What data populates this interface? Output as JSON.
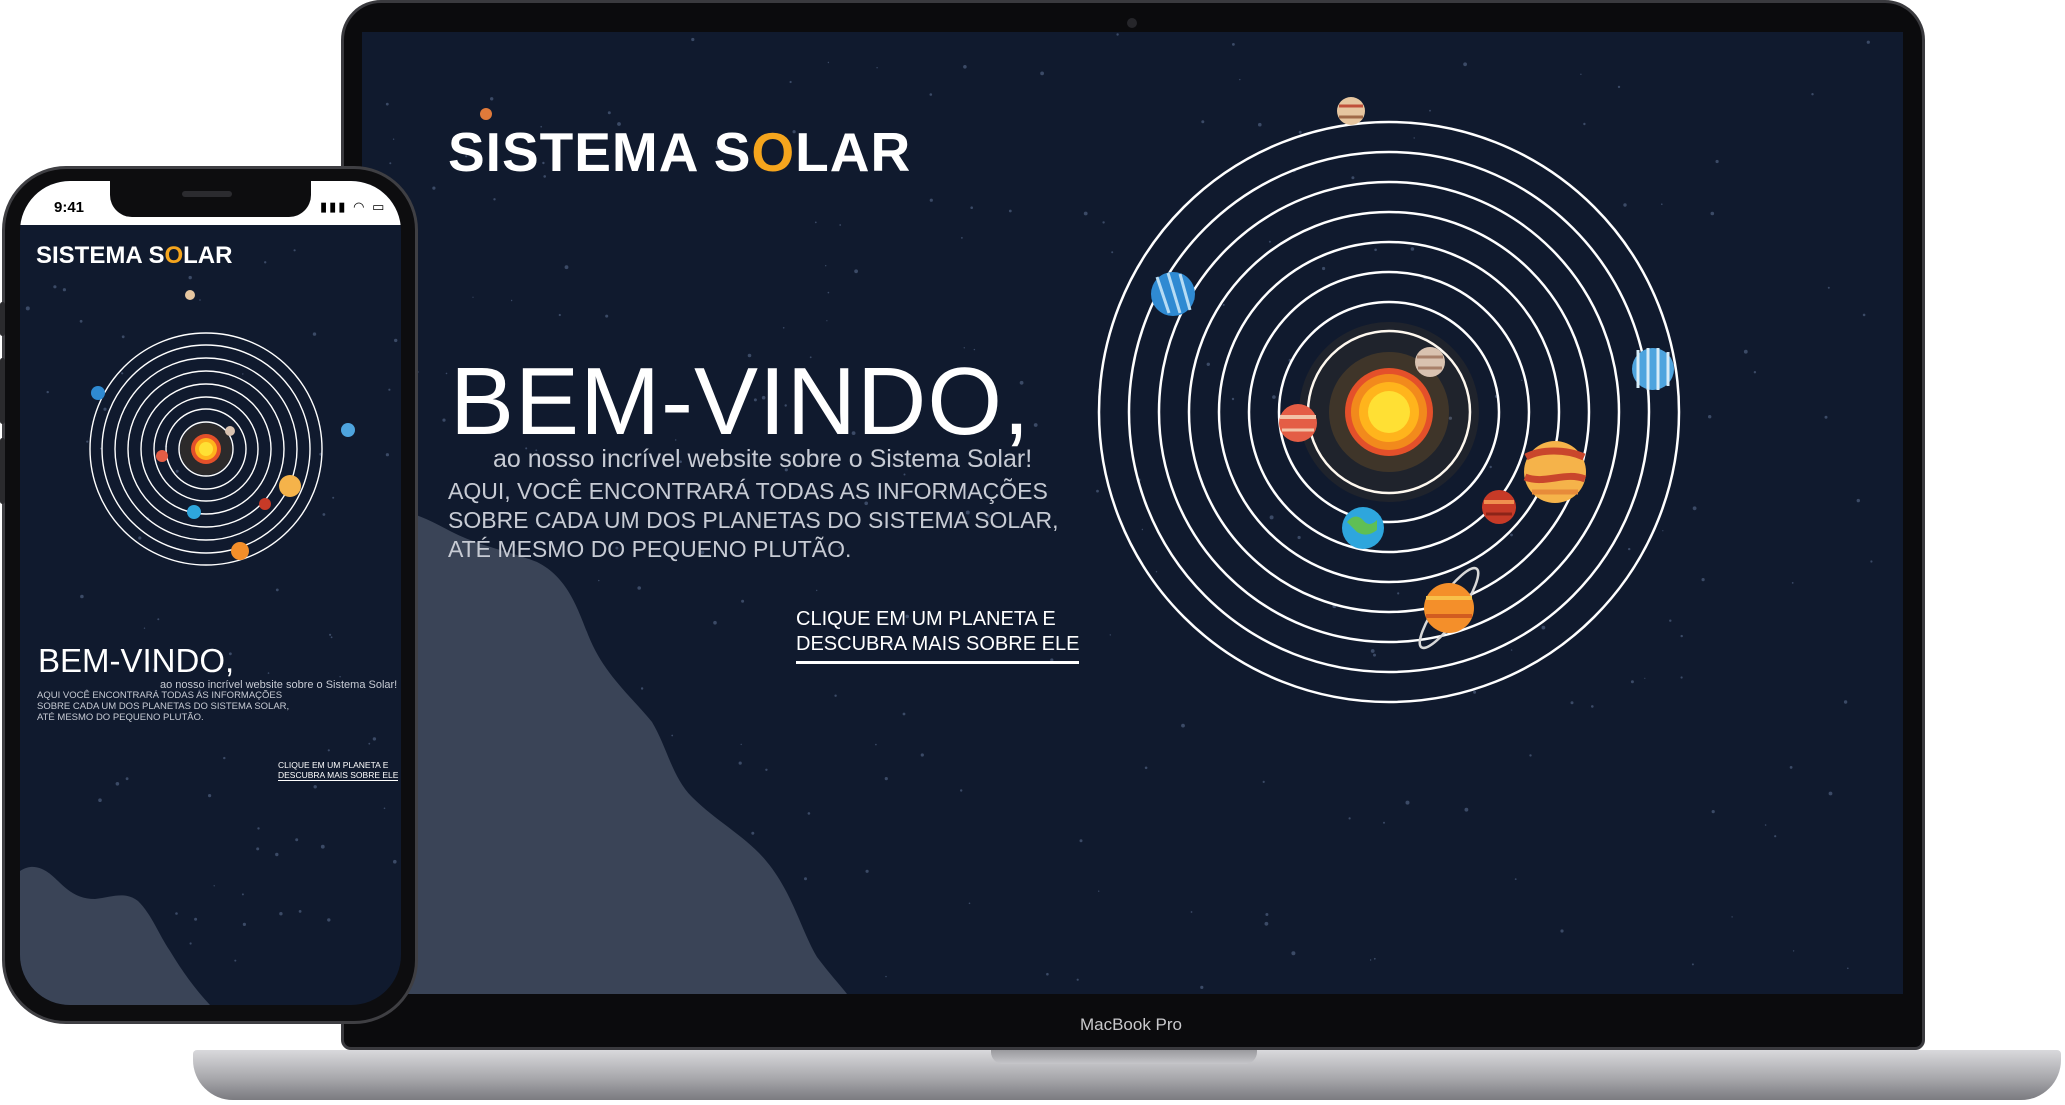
{
  "desktop": {
    "device_label": "MacBook Pro",
    "logo": {
      "part1": "SISTEMA S",
      "accent": "O",
      "part2": "LAR"
    },
    "hero": {
      "title": "BEM-VINDO,",
      "subtitle": "ao nosso incrível website sobre o Sistema Solar!",
      "body": [
        "AQUI, VOCÊ ENCONTRARÁ TODAS AS INFORMAÇÕES",
        "SOBRE CADA UM DOS PLANETAS DO SISTEMA SOLAR,",
        "ATÉ MESMO DO PEQUENO PLUTÃO."
      ],
      "cta": [
        "CLIQUE EM UM PLANETA E",
        "DESCUBRA MAIS SOBRE ELE"
      ]
    }
  },
  "mobile": {
    "status_time": "9:41",
    "logo": {
      "part1": "SISTEMA S",
      "accent": "O",
      "part2": "LAR"
    },
    "hero": {
      "title": "BEM-VINDO,",
      "subtitle": "ao nosso incrível website sobre o Sistema Solar!",
      "body": [
        "AQUI VOCÊ ENCONTRARÁ TODAS AS INFORMAÇÕES",
        "SOBRE CADA UM DOS PLANETAS DO SISTEMA SOLAR,",
        "ATÉ MESMO DO PEQUENO PLUTÃO."
      ],
      "cta": [
        "CLIQUE EM UM PLANETA E",
        "DESCUBRA MAIS SOBRE ELE"
      ]
    }
  },
  "colors": {
    "background": "#101a2e",
    "accent": "#f5a51d",
    "cloud": "#3a4457",
    "sun": "#ffc21a",
    "orbit": "#ffffff"
  },
  "planets": [
    "mercury-icon",
    "venus-icon",
    "earth-icon",
    "mars-icon",
    "jupiter-icon",
    "saturn-icon",
    "uranus-icon",
    "neptune-icon",
    "pluto-icon"
  ]
}
